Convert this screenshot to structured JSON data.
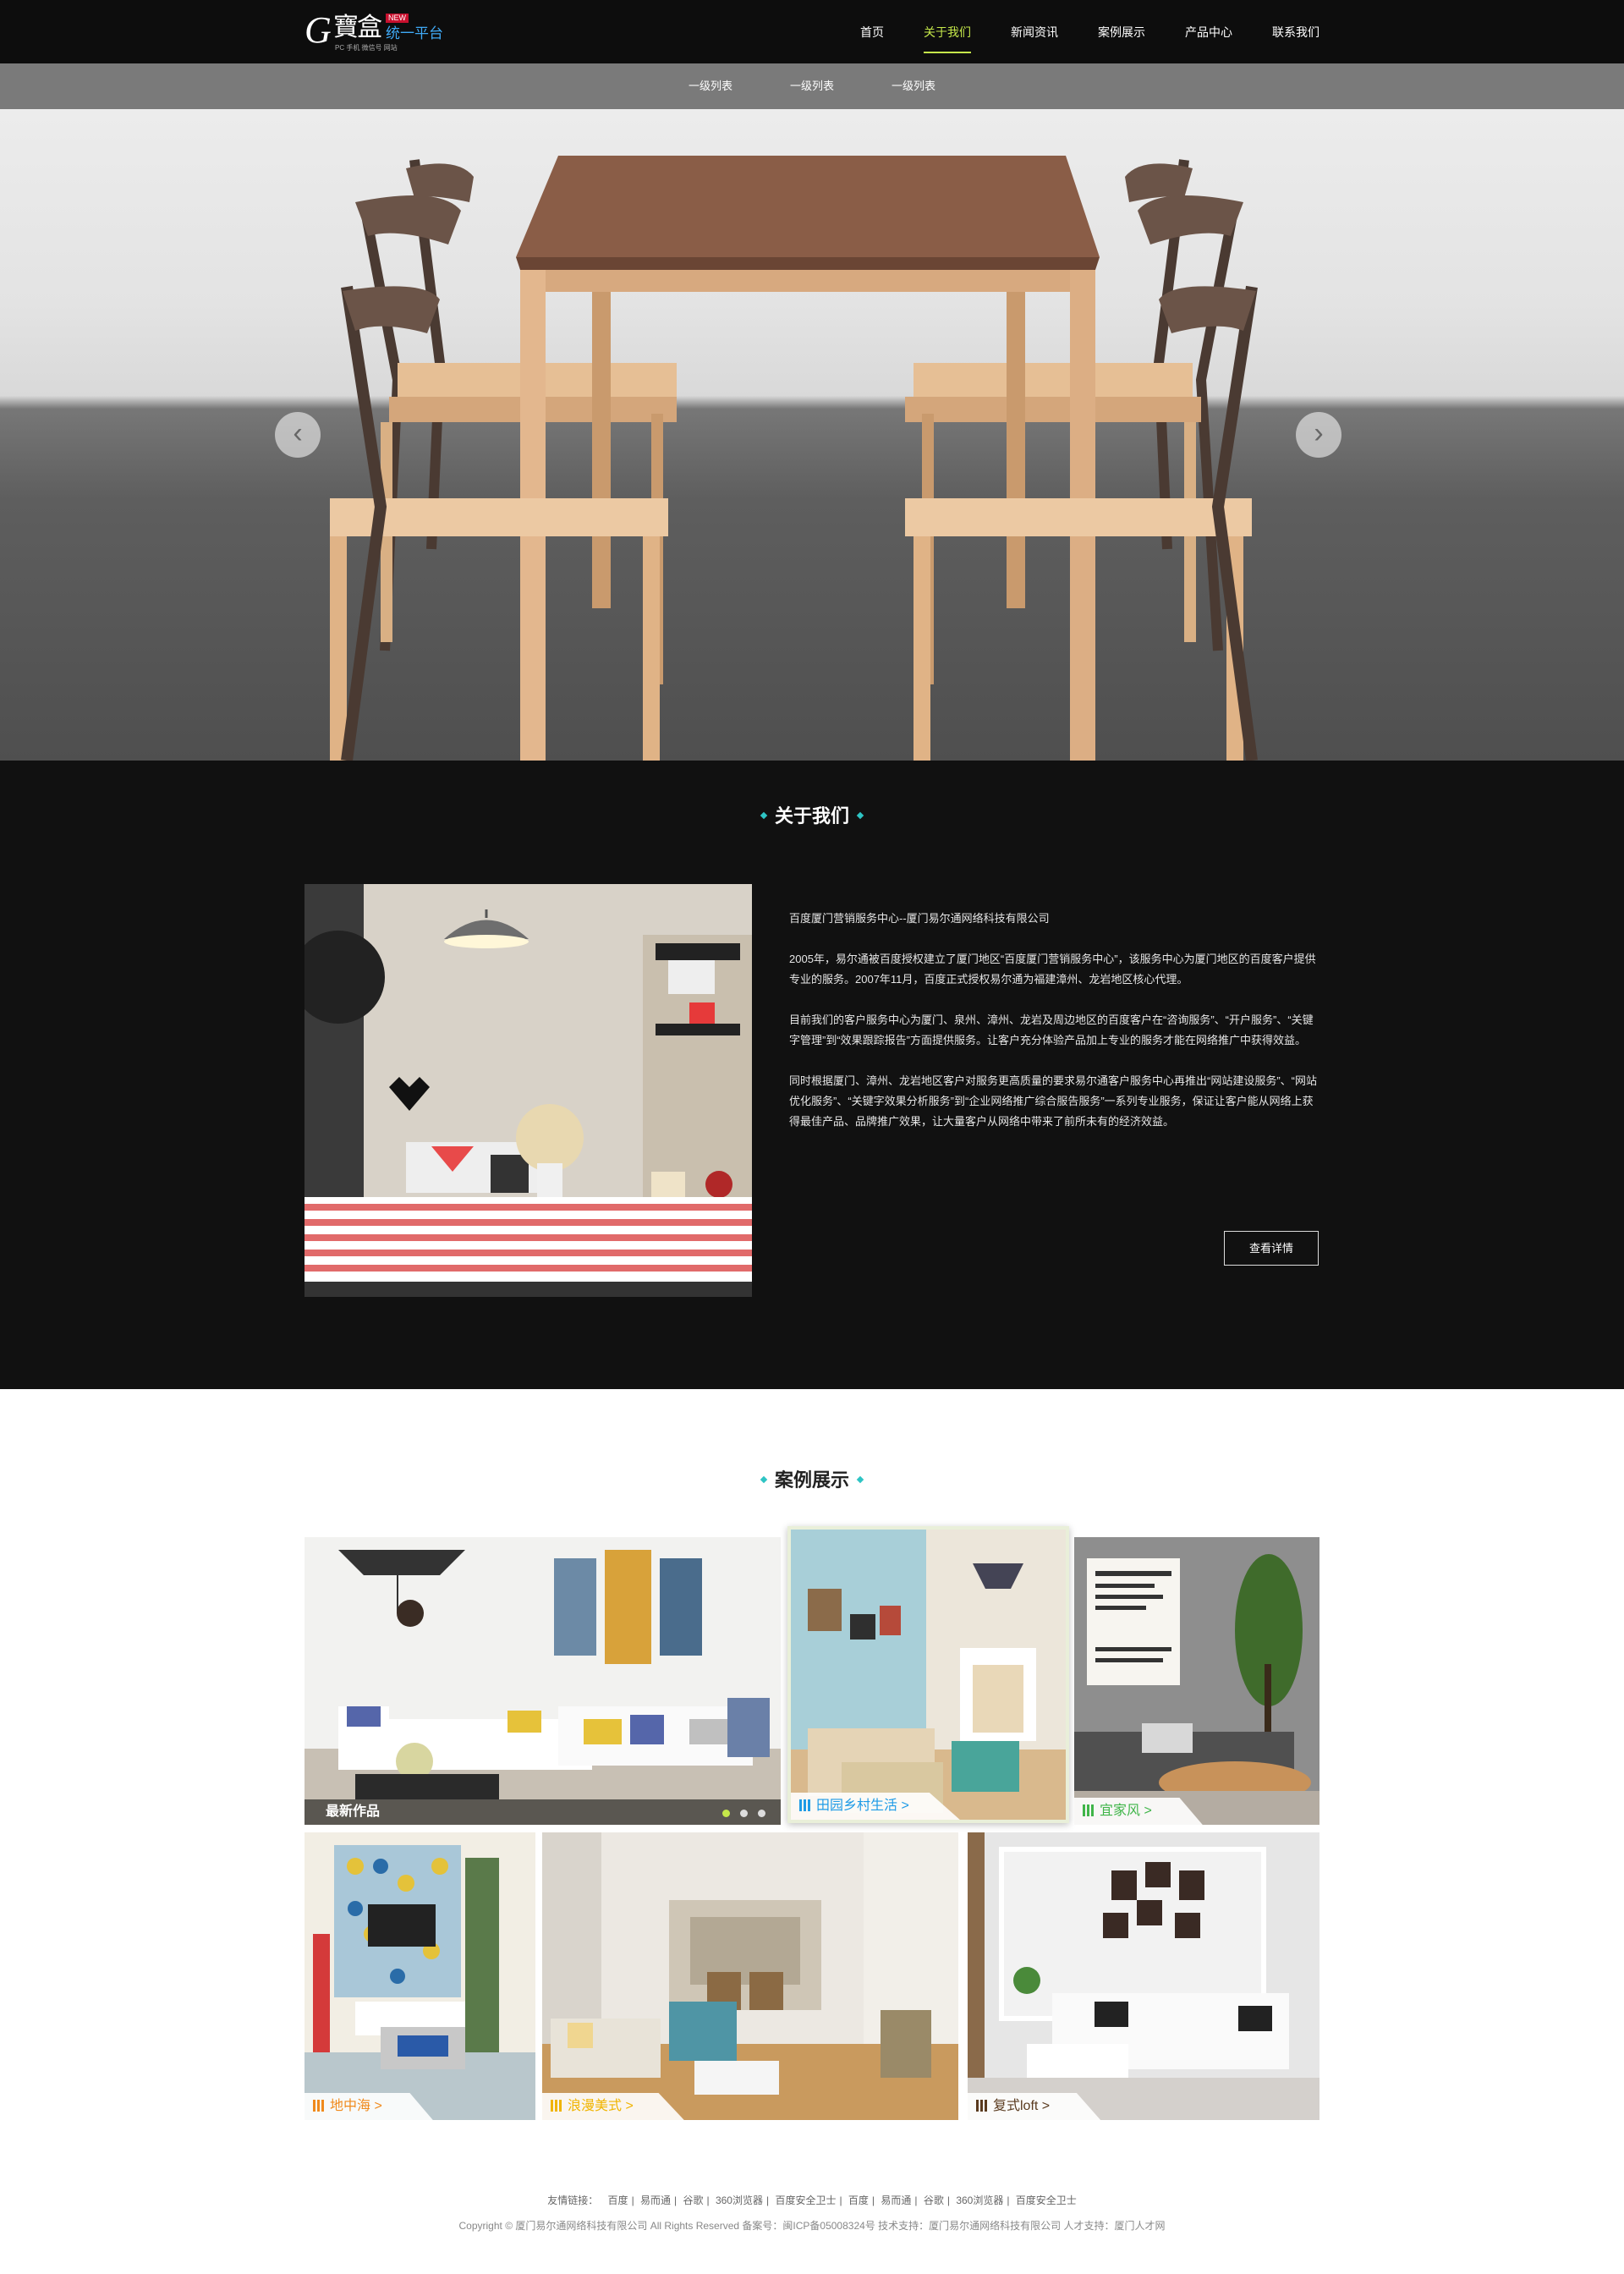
{
  "logo": {
    "letter": "G",
    "name": "寶盒",
    "badge": "NEW",
    "platform": "统一平台",
    "tagline": "PC 手机 微信号 网站"
  },
  "nav": {
    "items": [
      {
        "label": "首页"
      },
      {
        "label": "关于我们"
      },
      {
        "label": "新闻资讯"
      },
      {
        "label": "案例展示"
      },
      {
        "label": "产品中心"
      },
      {
        "label": "联系我们"
      }
    ],
    "active_index": 1,
    "active_color": "#c5e84a"
  },
  "subnav": {
    "items": [
      "一级列表",
      "一级列表",
      "一级列表"
    ]
  },
  "banner": {
    "prev_icon": "chevron-left-icon",
    "next_icon": "chevron-right-icon",
    "prev_glyph": "‹",
    "next_glyph": "›"
  },
  "about": {
    "title": "关于我们",
    "paragraphs": [
      "百度厦门营销服务中心--厦门易尔通网络科技有限公司",
      "2005年，易尔通被百度授权建立了厦门地区“百度厦门营销服务中心”，该服务中心为厦门地区的百度客户提供专业的服务。2007年11月，百度正式授权易尔通为福建漳州、龙岩地区核心代理。",
      "目前我们的客户服务中心为厦门、泉州、漳州、龙岩及周边地区的百度客户在“咨询服务”、“开户服务”、“关键字管理”到“效果跟踪报告”方面提供服务。让客户充分体验产品加上专业的服务才能在网络推广中获得效益。",
      "同时根据厦门、漳州、龙岩地区客户对服务更高质量的要求易尔通客户服务中心再推出“网站建设服务”、“网站优化服务”、“关键字效果分析服务”到“企业网络推广综合服告服务”一系列专业服务，保证让客户能从网络上获得最佳产品、品牌推广效果，让大量客户从网络中带来了前所未有的经济效益。"
    ],
    "more_label": "查看详情"
  },
  "cases": {
    "title": "案例展示",
    "featured_label": "最新作品",
    "items": [
      {
        "label": "田园乡村生活 >",
        "color": "#1e9be6"
      },
      {
        "label": "宜家风 >",
        "color": "#3fb549"
      },
      {
        "label": "地中海 >",
        "color": "#f08a1c"
      },
      {
        "label": "浪漫美式 >",
        "color": "#f0b400"
      },
      {
        "label": "复式loft >",
        "color": "#5a3a1e"
      }
    ],
    "accent_color": "#2ec4c4"
  },
  "footer": {
    "links_prefix": "友情链接：",
    "links": [
      "百度",
      "易而通",
      "谷歌",
      "360浏览器",
      "百度安全卫士",
      "百度",
      "易而通",
      "谷歌",
      "360浏览器",
      "百度安全卫士"
    ],
    "copyright": "Copyright © 厦门易尔通网络科技有限公司  All Rights Reserved 备案号：闽ICP备05008324号    技术支持：厦门易尔通网络科技有限公司    人才支持：厦门人才网"
  }
}
